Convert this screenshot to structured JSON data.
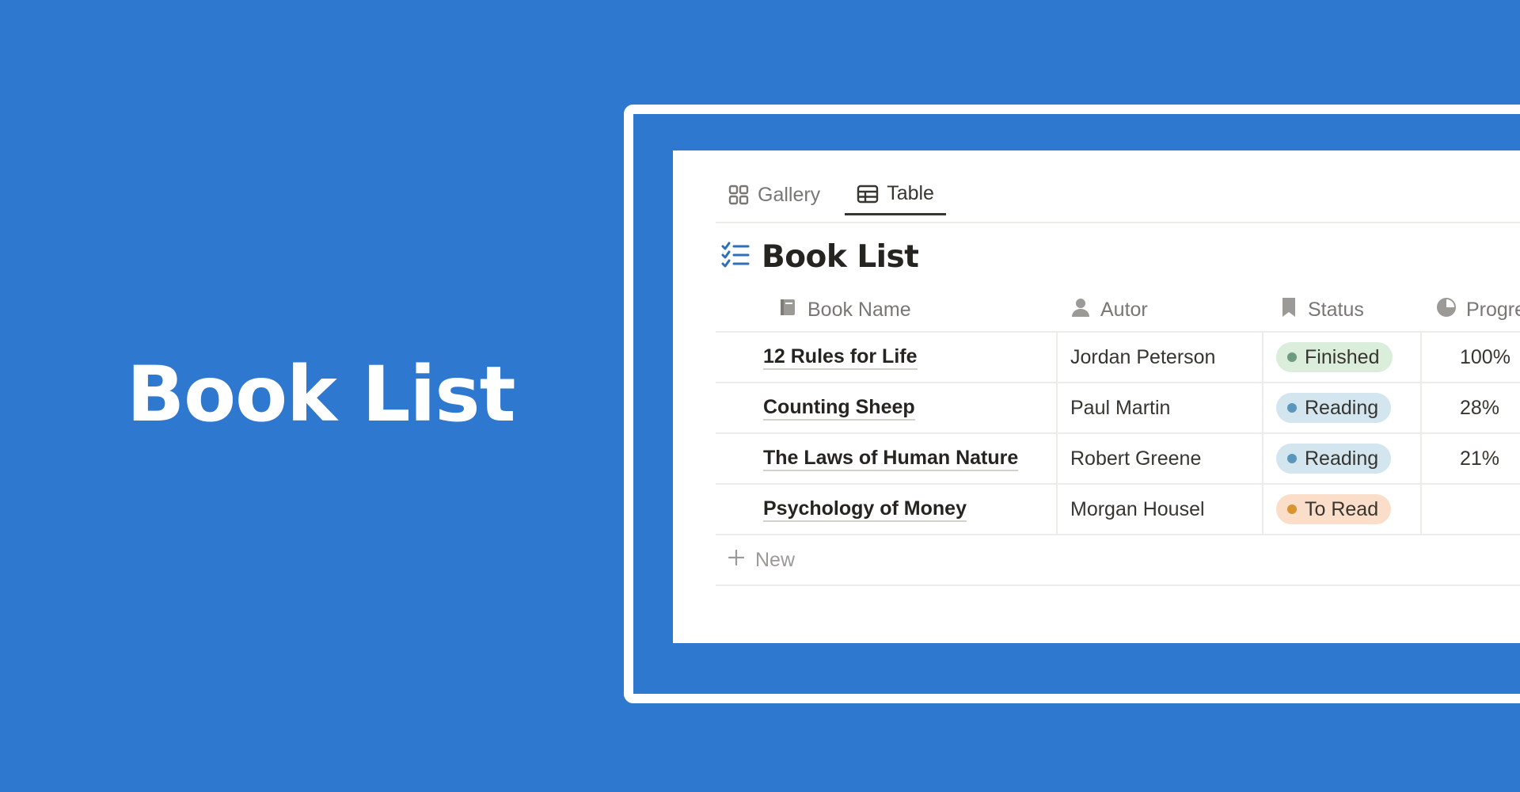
{
  "hero": {
    "title": "Book List"
  },
  "tabs": [
    {
      "label": "Gallery",
      "icon": "gallery-icon",
      "active": false
    },
    {
      "label": "Table",
      "icon": "table-icon",
      "active": true
    }
  ],
  "database": {
    "title": "Book List",
    "icon": "checklist-icon",
    "columns": [
      {
        "label": "Book Name",
        "icon": "book-icon"
      },
      {
        "label": "Autor",
        "icon": "person-icon"
      },
      {
        "label": "Status",
        "icon": "bookmark-icon"
      },
      {
        "label": "Progress",
        "icon": "pie-icon"
      }
    ],
    "rows": [
      {
        "name": "12 Rules for Life",
        "author": "Jordan Peterson",
        "status": "Finished",
        "status_bg": "#DBEDDB",
        "status_dot": "#6C9B7D",
        "progress": "100%"
      },
      {
        "name": "Counting Sheep",
        "author": "Paul Martin",
        "status": "Reading",
        "status_bg": "#D3E5EF",
        "status_dot": "#5B97BD",
        "progress": "28%"
      },
      {
        "name": "The Laws of Human Nature",
        "author": "Robert Greene",
        "status": "Reading",
        "status_bg": "#D3E5EF",
        "status_dot": "#5B97BD",
        "progress": "21%"
      },
      {
        "name": "Psychology of Money",
        "author": "Morgan Housel",
        "status": "To Read",
        "status_bg": "#FADEC9",
        "status_dot": "#D9932F",
        "progress": ""
      }
    ],
    "new_label": "New"
  },
  "colors": {
    "background": "#2F78CF",
    "accent_icon": "#2F6FB8"
  }
}
